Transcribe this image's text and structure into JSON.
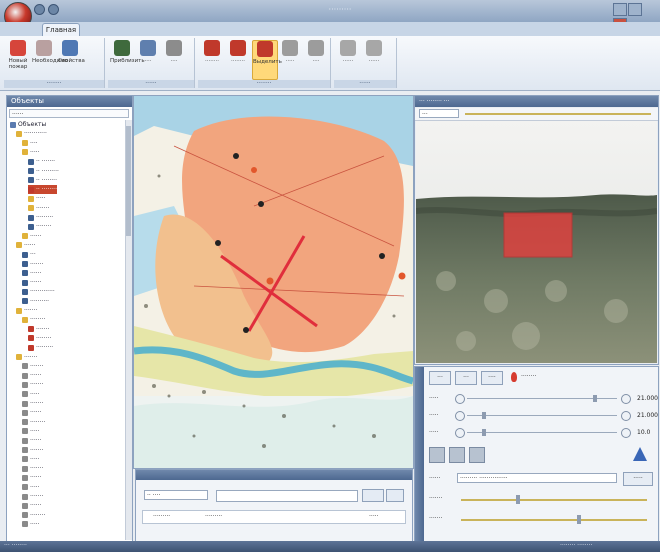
{
  "window": {
    "title": "·········",
    "tab": "Главная"
  },
  "ribbon": {
    "groups": [
      {
        "label": "········",
        "buttons": [
          {
            "label": "Новый пожар",
            "color": "#d6453b"
          },
          {
            "label": "Необходимо",
            "color": "#b9a0a0"
          },
          {
            "label": "Свойства",
            "color": "#4f78b4"
          }
        ]
      },
      {
        "label": "······",
        "buttons": [
          {
            "label": "Приблизить",
            "color": "#3f6a3d"
          },
          {
            "label": "····",
            "color": "#5f7fae"
          },
          {
            "label": "····",
            "color": "#8c8c8c"
          }
        ]
      },
      {
        "label": "········",
        "buttons": [
          {
            "label": "········",
            "color": "#c0392b"
          },
          {
            "label": "········",
            "color": "#c0392b"
          },
          {
            "label": "Выделить",
            "color": "#c0392b",
            "active": true
          },
          {
            "label": "·····",
            "color": "#9c9c9c"
          },
          {
            "label": "····",
            "color": "#9c9c9c"
          }
        ]
      },
      {
        "label": "······",
        "buttons": [
          {
            "label": "······",
            "color": "#a7a7a7"
          },
          {
            "label": "······",
            "color": "#a7a7a7"
          }
        ]
      }
    ]
  },
  "left_panel": {
    "title": "Объекты",
    "search": "······",
    "tree": [
      {
        "label": "Объекты",
        "indent": 0,
        "color": "#5b7bb0"
      },
      {
        "label": "············",
        "indent": 1,
        "color": "#e0b23a"
      },
      {
        "label": "····",
        "indent": 2,
        "color": "#e0b23a"
      },
      {
        "label": "·····",
        "indent": 2,
        "color": "#e0b23a"
      },
      {
        "label": "·· ·······",
        "indent": 3,
        "color": "#3d5f8f"
      },
      {
        "label": "·· ·········",
        "indent": 3,
        "color": "#3d5f8f"
      },
      {
        "label": "·· ········",
        "indent": 3,
        "color": "#3d5f8f"
      },
      {
        "label": "·· ········",
        "indent": 3,
        "color": "#c0392b",
        "selected": true
      },
      {
        "label": "·····",
        "indent": 3,
        "color": "#e0b23a"
      },
      {
        "label": "·······",
        "indent": 3,
        "color": "#e0b23a"
      },
      {
        "label": "·········",
        "indent": 3,
        "color": "#3d5f8f"
      },
      {
        "label": "········",
        "indent": 3,
        "color": "#3d5f8f"
      },
      {
        "label": "······",
        "indent": 2,
        "color": "#e0b23a"
      },
      {
        "label": "······",
        "indent": 1,
        "color": "#e0b23a"
      },
      {
        "label": "···",
        "indent": 2,
        "color": "#3d5f8f"
      },
      {
        "label": "·······",
        "indent": 2,
        "color": "#3d5f8f"
      },
      {
        "label": "······",
        "indent": 2,
        "color": "#3d5f8f"
      },
      {
        "label": "······",
        "indent": 2,
        "color": "#3d5f8f"
      },
      {
        "label": "·············",
        "indent": 2,
        "color": "#3d5f8f"
      },
      {
        "label": "··········",
        "indent": 2,
        "color": "#3d5f8f"
      },
      {
        "label": "·······",
        "indent": 1,
        "color": "#e0b23a"
      },
      {
        "label": "········",
        "indent": 2,
        "color": "#e0b23a"
      },
      {
        "label": "·······",
        "indent": 3,
        "color": "#c0392b"
      },
      {
        "label": "········",
        "indent": 3,
        "color": "#c0392b"
      },
      {
        "label": "·········",
        "indent": 3,
        "color": "#c0392b"
      },
      {
        "label": "·······",
        "indent": 1,
        "color": "#e0b23a"
      },
      {
        "label": "·······",
        "indent": 2,
        "color": "#8a8a8a"
      },
      {
        "label": "······",
        "indent": 2,
        "color": "#8a8a8a"
      },
      {
        "label": "·······",
        "indent": 2,
        "color": "#8a8a8a"
      },
      {
        "label": "·····",
        "indent": 2,
        "color": "#8a8a8a"
      },
      {
        "label": "·······",
        "indent": 2,
        "color": "#8a8a8a"
      },
      {
        "label": "······",
        "indent": 2,
        "color": "#8a8a8a"
      },
      {
        "label": "········",
        "indent": 2,
        "color": "#8a8a8a"
      },
      {
        "label": "·····",
        "indent": 2,
        "color": "#8a8a8a"
      },
      {
        "label": "······",
        "indent": 2,
        "color": "#8a8a8a"
      },
      {
        "label": "·······",
        "indent": 2,
        "color": "#8a8a8a"
      },
      {
        "label": "·····",
        "indent": 2,
        "color": "#8a8a8a"
      },
      {
        "label": "·······",
        "indent": 2,
        "color": "#8a8a8a"
      },
      {
        "label": "······",
        "indent": 2,
        "color": "#8a8a8a"
      },
      {
        "label": "·····",
        "indent": 2,
        "color": "#8a8a8a"
      },
      {
        "label": "·······",
        "indent": 2,
        "color": "#8a8a8a"
      },
      {
        "label": "······",
        "indent": 2,
        "color": "#8a8a8a"
      },
      {
        "label": "········",
        "indent": 2,
        "color": "#8a8a8a"
      },
      {
        "label": "·····",
        "indent": 2,
        "color": "#8a8a8a"
      }
    ]
  },
  "map": {
    "layer_label": "······"
  },
  "bottom_panel": {
    "combo": "·· ····",
    "row_label1": "·········",
    "row_label2": "·········",
    "row_label3": "·····"
  },
  "video": {
    "title": "··· ········ ···",
    "combo": "···"
  },
  "controls": {
    "mode_buttons": [
      "···",
      "···",
      "····"
    ],
    "fire_label": "········",
    "sliders": [
      {
        "label": "·····",
        "value": "21.000",
        "level": 0.86
      },
      {
        "label": "·····",
        "value": "21.000",
        "level": 0.1
      },
      {
        "label": "·····",
        "value": "10.0",
        "level": 0.1
      }
    ],
    "route_label": "······",
    "route_value": "········· ···············",
    "route_btn": "·····",
    "speed_label1": "·······",
    "speed_label2": "·······",
    "speed_level1": 0.3,
    "speed_level2": 0.64
  },
  "status": {
    "left": "··· ········",
    "right": "········ ········"
  }
}
